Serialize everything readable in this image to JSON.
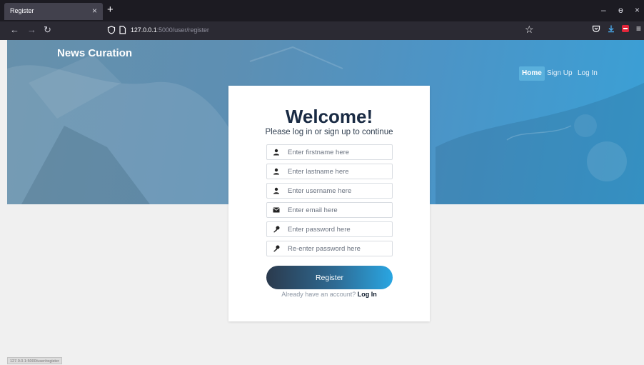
{
  "browser": {
    "tab_title": "Register",
    "tab_close": "×",
    "new_tab": "+",
    "url_host": "127.0.0.1",
    "url_rest": ":5000/user/register",
    "controls": {
      "minimize": "–",
      "restore": "ɵ",
      "close": "×"
    }
  },
  "site": {
    "brand": "News Curation",
    "nav": {
      "home": "Home",
      "signup": "Sign Up",
      "login": "Log In"
    }
  },
  "form": {
    "title": "Welcome!",
    "subtitle": "Please log in or sign up to continue",
    "fields": [
      {
        "icon": "user-icon",
        "placeholder": "Enter firstname here"
      },
      {
        "icon": "user-icon",
        "placeholder": "Enter lastname here"
      },
      {
        "icon": "user-icon",
        "placeholder": "Enter username here"
      },
      {
        "icon": "envelope-icon",
        "placeholder": "Enter email here"
      },
      {
        "icon": "key-icon",
        "placeholder": "Enter password here"
      },
      {
        "icon": "key-icon",
        "placeholder": "Re-enter password here"
      }
    ],
    "submit_label": "Register",
    "switch_text": "Already have an account?",
    "switch_link": "Log In"
  },
  "status_bar": "127.0.0.1:5000/user/register",
  "colors": {
    "hero_start": "#6790ab",
    "hero_end": "#3aa0d6",
    "title": "#1a2b44",
    "button_start": "#2b3a4d",
    "button_end": "#2aa6e2"
  }
}
